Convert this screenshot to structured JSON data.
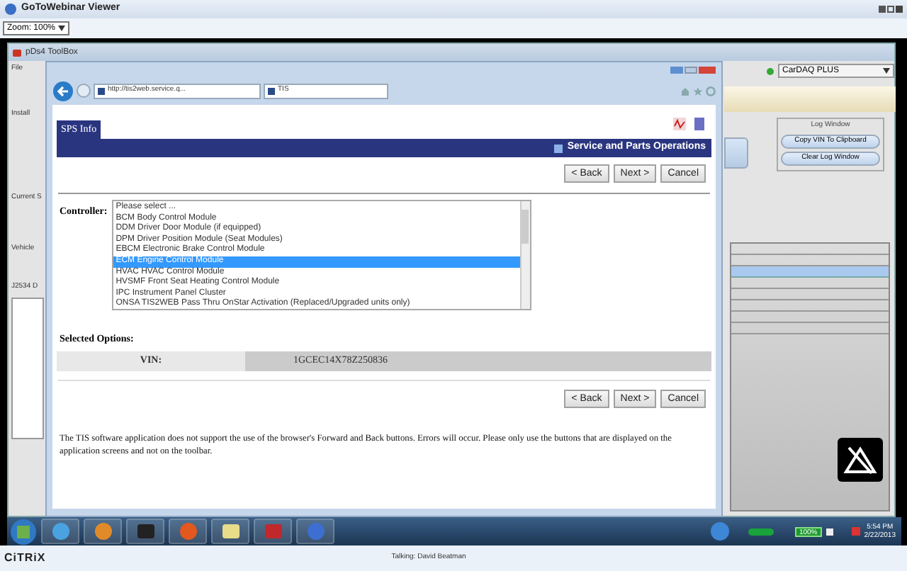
{
  "viewer": {
    "title": "GoToWebinar Viewer",
    "zoom": "Zoom: 100%"
  },
  "toolbox": {
    "title": "pDs4 ToolBox",
    "left_fragments": [
      "File",
      "Install",
      "Current S",
      "Vehicle",
      "J2534 D"
    ],
    "device": "CarDAQ PLUS",
    "log_group": "Log Window",
    "log_buttons": [
      "Copy VIN To Clipboard",
      "Clear Log Window"
    ]
  },
  "browser": {
    "address": "http://tis2web.service.q...",
    "tab": "TIS"
  },
  "page": {
    "tab": "SPS Info",
    "banner": "Service and Parts Operations",
    "buttons_top": [
      "< Back",
      "Next >",
      "Cancel"
    ],
    "controller_label": "Controller:",
    "options": [
      {
        "label": "Please select ...",
        "selected": false
      },
      {
        "label": "BCM Body Control Module",
        "selected": false
      },
      {
        "label": "DDM Driver Door Module (if equipped)",
        "selected": false
      },
      {
        "label": "DPM Driver Position Module (Seat Modules)",
        "selected": false
      },
      {
        "label": "EBCM Electronic Brake Control Module",
        "selected": false
      },
      {
        "label": "ECM Engine Control Module",
        "selected": true
      },
      {
        "label": "HVAC HVAC Control Module",
        "selected": false
      },
      {
        "label": "HVSMF Front Seat Heating Control Module",
        "selected": false
      },
      {
        "label": "IPC Instrument Panel Cluster",
        "selected": false
      },
      {
        "label": "ONSA TIS2WEB Pass Thru OnStar Activation (Replaced/Upgraded units only)",
        "selected": false
      }
    ],
    "selected_options_title": "Selected Options:",
    "vin_label": "VIN:",
    "vin": "1GCEC14X78Z250836",
    "buttons_bottom": [
      "< Back",
      "Next >",
      "Cancel"
    ],
    "notice": "The TIS software application does not support the use of the browser's Forward and Back buttons. Errors will occur. Please only use the buttons that are displayed on the application screens and not on the toolbar."
  },
  "taskbar": {
    "battery": "100%",
    "time": "5:54 PM",
    "date": "2/22/2013"
  },
  "footer": {
    "brand": "CiTRiX",
    "speaker": "Talking: David Beatman"
  }
}
